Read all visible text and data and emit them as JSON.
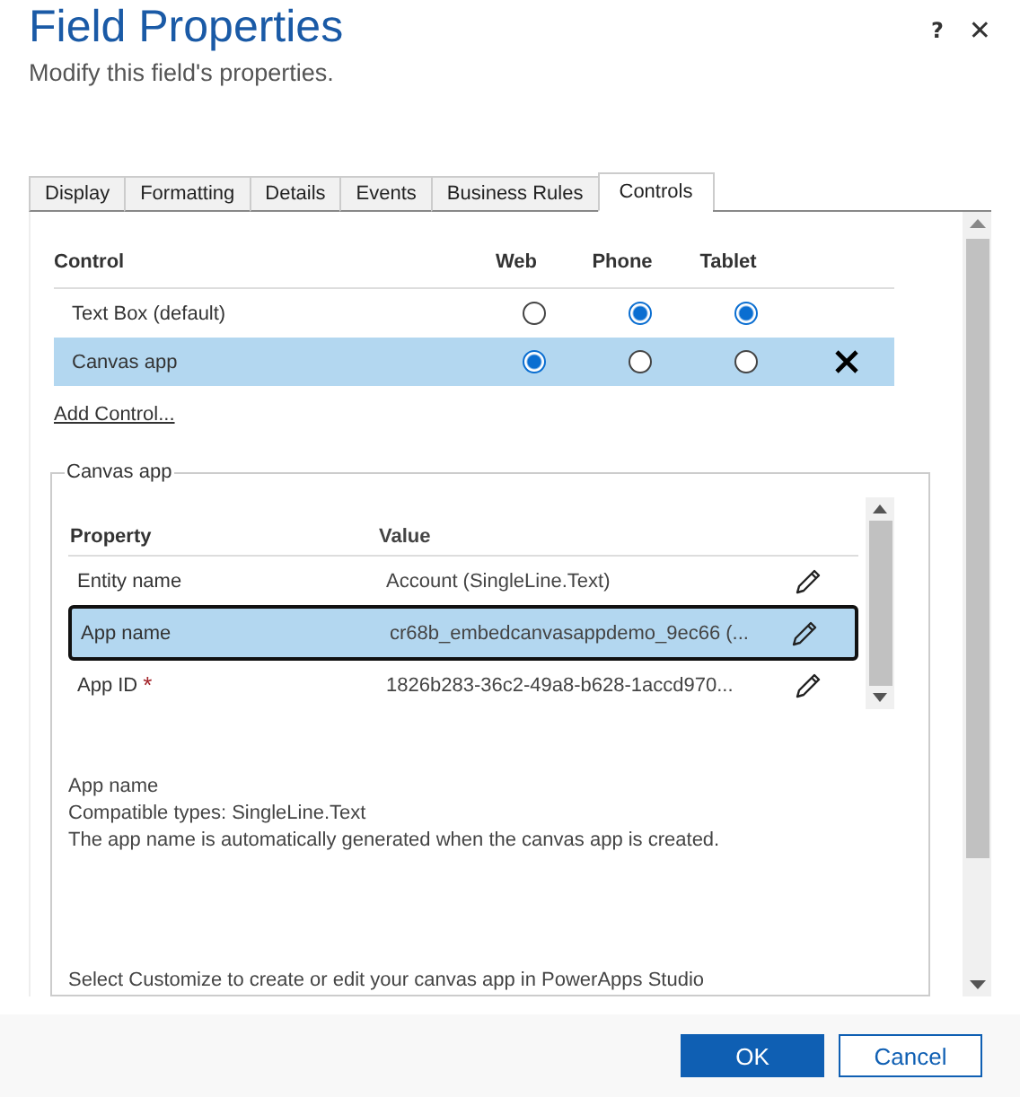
{
  "dialog": {
    "title": "Field Properties",
    "subtitle": "Modify this field's properties.",
    "help": "?",
    "close": "✕"
  },
  "tabs": [
    {
      "label": "Display",
      "selected": false
    },
    {
      "label": "Formatting",
      "selected": false
    },
    {
      "label": "Details",
      "selected": false
    },
    {
      "label": "Events",
      "selected": false
    },
    {
      "label": "Business Rules",
      "selected": false
    },
    {
      "label": "Controls",
      "selected": true
    }
  ],
  "controls_table": {
    "columns": [
      "Control",
      "Web",
      "Phone",
      "Tablet"
    ],
    "rows": [
      {
        "name": "Text Box (default)",
        "selected": false,
        "web": false,
        "phone": true,
        "tablet": true,
        "removable": false
      },
      {
        "name": "Canvas app",
        "selected": true,
        "web": true,
        "phone": false,
        "tablet": false,
        "removable": true
      }
    ]
  },
  "add_control": "Add Control...",
  "group": {
    "legend": "Canvas app",
    "columns": [
      "Property",
      "Value"
    ],
    "rows": [
      {
        "property": "Entity name",
        "value": "Account (SingleLine.Text)",
        "selected": false
      },
      {
        "property": "App name",
        "value": "cr68b_embedcanvasappdemo_9ec66 (...",
        "selected": true
      },
      {
        "property": "App ID",
        "value": "1826b283-36c2-49a8-b628-1accd970...",
        "required_mark": "*",
        "selected": false
      }
    ],
    "description": [
      "App name",
      "Compatible types: SingleLine.Text",
      "The app name is automatically generated when the canvas app is created."
    ],
    "hint": "Select Customize to create or edit your canvas app in PowerApps Studio"
  },
  "buttons": [
    {
      "label": "OK",
      "kind": "primary"
    },
    {
      "label": "Cancel",
      "kind": "secondary"
    }
  ]
}
